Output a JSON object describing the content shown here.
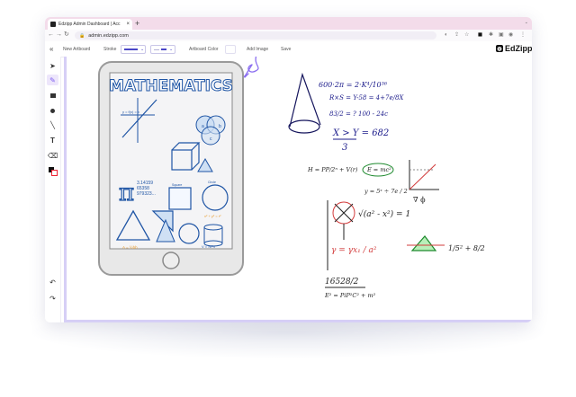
{
  "browser": {
    "tab_title": "Edzipp Admin Dashboard | Acc",
    "url": "admin.edzipp.com"
  },
  "toolbar": {
    "collapse_label": "«",
    "new_artboard": "New Artboard",
    "stroke": "Stroke",
    "artboard_color": "Artboard Color",
    "add_image": "Add Image",
    "save": "Save",
    "stroke_color": "#4a46c8"
  },
  "brand": {
    "name": "EdZipp"
  },
  "sidebar": {
    "tools": [
      "pointer-icon",
      "pencil-icon",
      "rectangle-icon",
      "circle-icon",
      "line-icon",
      "text-icon",
      "eraser-icon",
      "color-picker-icon"
    ],
    "undo_icon": "undo-icon",
    "redo_icon": "redo-icon",
    "active_color": "#7d5cf0"
  },
  "tablet": {
    "heading": "MATHEMATICS",
    "func": "y = f(x) = x",
    "pi": "π",
    "pi_digits": "3.14159\n65358\n979323...",
    "square": "Square",
    "circle": "Circle",
    "venn": [
      "a",
      "b",
      "c"
    ],
    "formula": "x² + y² = r²",
    "bottom_label": "A = ½bh",
    "dims": "V = πr²h"
  },
  "notes": {
    "line1": "600·2π = 2·K⁴/10³⁶",
    "line2": "R×S = Y-58 = 4+7e/8X",
    "line3": "83/2 = ? 100 - 24c",
    "line4": "X > Y = 682",
    "line4_den": "3",
    "line5": "H = PP/2ⁿ + V(r)",
    "emc": "E = mc²",
    "line6": "y = 5ˣ ÷ 7e / 2",
    "line7": "∇ ϕ",
    "sqrt": "√(a² - x²) = 1",
    "gamma": "γ = γx₁ / a²",
    "frac": "1/5² + 8/2",
    "line8": "16528/2",
    "line9": "E² = PiP²C² + m²"
  }
}
